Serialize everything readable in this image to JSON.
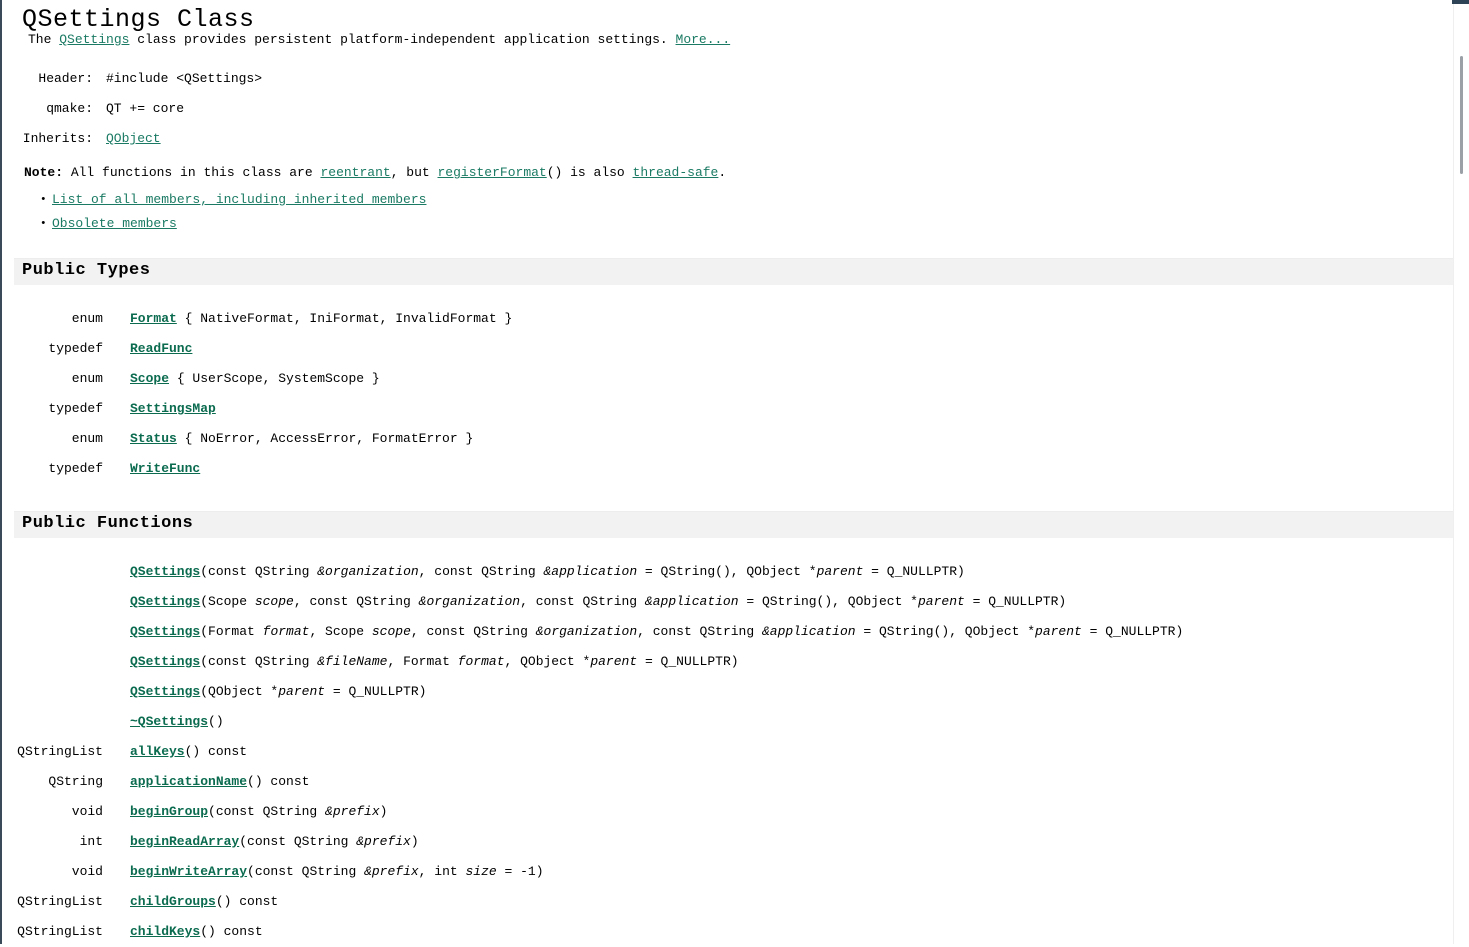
{
  "page": {
    "title": "QSettings Class"
  },
  "brief": {
    "prefix": "The ",
    "class_link": "QSettings",
    "text": " class provides persistent platform-independent application settings. ",
    "more_link": "More..."
  },
  "meta": {
    "rows": [
      {
        "label": "Header:",
        "value": "#include <QSettings>",
        "is_link": false
      },
      {
        "label": "qmake:",
        "value": "QT += core",
        "is_link": false
      },
      {
        "label": "Inherits:",
        "value": "QObject",
        "is_link": true
      }
    ]
  },
  "note": {
    "label": "Note:",
    "part1": " All functions in this class are ",
    "link1": "reentrant",
    "part2": ", but ",
    "link2": "registerFormat",
    "part3": "() is also ",
    "link3": "thread-safe",
    "part4": "."
  },
  "member_links": [
    "List of all members, including inherited members",
    "Obsolete members"
  ],
  "sections": {
    "public_types": {
      "title": "Public Types",
      "rows": [
        {
          "kind": "enum",
          "name": "Format",
          "detail": " { NativeFormat, IniFormat, InvalidFormat }"
        },
        {
          "kind": "typedef",
          "name": "ReadFunc",
          "detail": ""
        },
        {
          "kind": "enum",
          "name": "Scope",
          "detail": " { UserScope, SystemScope }"
        },
        {
          "kind": "typedef",
          "name": "SettingsMap",
          "detail": ""
        },
        {
          "kind": "enum",
          "name": "Status",
          "detail": " { NoError, AccessError, FormatError }"
        },
        {
          "kind": "typedef",
          "name": "WriteFunc",
          "detail": ""
        }
      ]
    },
    "public_functions": {
      "title": "Public Functions",
      "rows": [
        {
          "ret": "",
          "name": "QSettings",
          "sig_parts": [
            {
              "t": "plain",
              "v": "(const QString "
            },
            {
              "t": "param",
              "v": "&organization"
            },
            {
              "t": "plain",
              "v": ", const QString "
            },
            {
              "t": "param",
              "v": "&application"
            },
            {
              "t": "plain",
              "v": " = QString(), QObject *"
            },
            {
              "t": "param",
              "v": "parent"
            },
            {
              "t": "plain",
              "v": " = Q_NULLPTR)"
            }
          ]
        },
        {
          "ret": "",
          "name": "QSettings",
          "sig_parts": [
            {
              "t": "plain",
              "v": "(Scope "
            },
            {
              "t": "param",
              "v": "scope"
            },
            {
              "t": "plain",
              "v": ", const QString "
            },
            {
              "t": "param",
              "v": "&organization"
            },
            {
              "t": "plain",
              "v": ", const QString "
            },
            {
              "t": "param",
              "v": "&application"
            },
            {
              "t": "plain",
              "v": " = QString(), QObject *"
            },
            {
              "t": "param",
              "v": "parent"
            },
            {
              "t": "plain",
              "v": " = Q_NULLPTR)"
            }
          ]
        },
        {
          "ret": "",
          "name": "QSettings",
          "sig_parts": [
            {
              "t": "plain",
              "v": "(Format "
            },
            {
              "t": "param",
              "v": "format"
            },
            {
              "t": "plain",
              "v": ", Scope "
            },
            {
              "t": "param",
              "v": "scope"
            },
            {
              "t": "plain",
              "v": ", const QString "
            },
            {
              "t": "param",
              "v": "&organization"
            },
            {
              "t": "plain",
              "v": ", const QString "
            },
            {
              "t": "param",
              "v": "&application"
            },
            {
              "t": "plain",
              "v": " = QString(), QObject *"
            },
            {
              "t": "param",
              "v": "parent"
            },
            {
              "t": "plain",
              "v": " = Q_NULLPTR)"
            }
          ]
        },
        {
          "ret": "",
          "name": "QSettings",
          "sig_parts": [
            {
              "t": "plain",
              "v": "(const QString "
            },
            {
              "t": "param",
              "v": "&fileName"
            },
            {
              "t": "plain",
              "v": ", Format "
            },
            {
              "t": "param",
              "v": "format"
            },
            {
              "t": "plain",
              "v": ", QObject *"
            },
            {
              "t": "param",
              "v": "parent"
            },
            {
              "t": "plain",
              "v": " = Q_NULLPTR)"
            }
          ]
        },
        {
          "ret": "",
          "name": "QSettings",
          "sig_parts": [
            {
              "t": "plain",
              "v": "(QObject *"
            },
            {
              "t": "param",
              "v": "parent"
            },
            {
              "t": "plain",
              "v": " = Q_NULLPTR)"
            }
          ]
        },
        {
          "ret": "",
          "name": "~QSettings",
          "sig_parts": [
            {
              "t": "plain",
              "v": "()"
            }
          ]
        },
        {
          "ret": "QStringList",
          "name": "allKeys",
          "sig_parts": [
            {
              "t": "plain",
              "v": "() const"
            }
          ]
        },
        {
          "ret": "QString",
          "name": "applicationName",
          "sig_parts": [
            {
              "t": "plain",
              "v": "() const"
            }
          ]
        },
        {
          "ret": "void",
          "name": "beginGroup",
          "sig_parts": [
            {
              "t": "plain",
              "v": "(const QString "
            },
            {
              "t": "param",
              "v": "&prefix"
            },
            {
              "t": "plain",
              "v": ")"
            }
          ]
        },
        {
          "ret": "int",
          "name": "beginReadArray",
          "sig_parts": [
            {
              "t": "plain",
              "v": "(const QString "
            },
            {
              "t": "param",
              "v": "&prefix"
            },
            {
              "t": "plain",
              "v": ")"
            }
          ]
        },
        {
          "ret": "void",
          "name": "beginWriteArray",
          "sig_parts": [
            {
              "t": "plain",
              "v": "(const QString "
            },
            {
              "t": "param",
              "v": "&prefix"
            },
            {
              "t": "plain",
              "v": ", int "
            },
            {
              "t": "param",
              "v": "size"
            },
            {
              "t": "plain",
              "v": " = -1)"
            }
          ]
        },
        {
          "ret": "QStringList",
          "name": "childGroups",
          "sig_parts": [
            {
              "t": "plain",
              "v": "() const"
            }
          ]
        },
        {
          "ret": "QStringList",
          "name": "childKeys",
          "sig_parts": [
            {
              "t": "plain",
              "v": "() const"
            }
          ]
        }
      ]
    }
  },
  "colors": {
    "link": "#1a7a63",
    "symbol": "#0b6b4f",
    "section_bar": "#f2f2f2",
    "chrome_bar": "#2e4356"
  }
}
